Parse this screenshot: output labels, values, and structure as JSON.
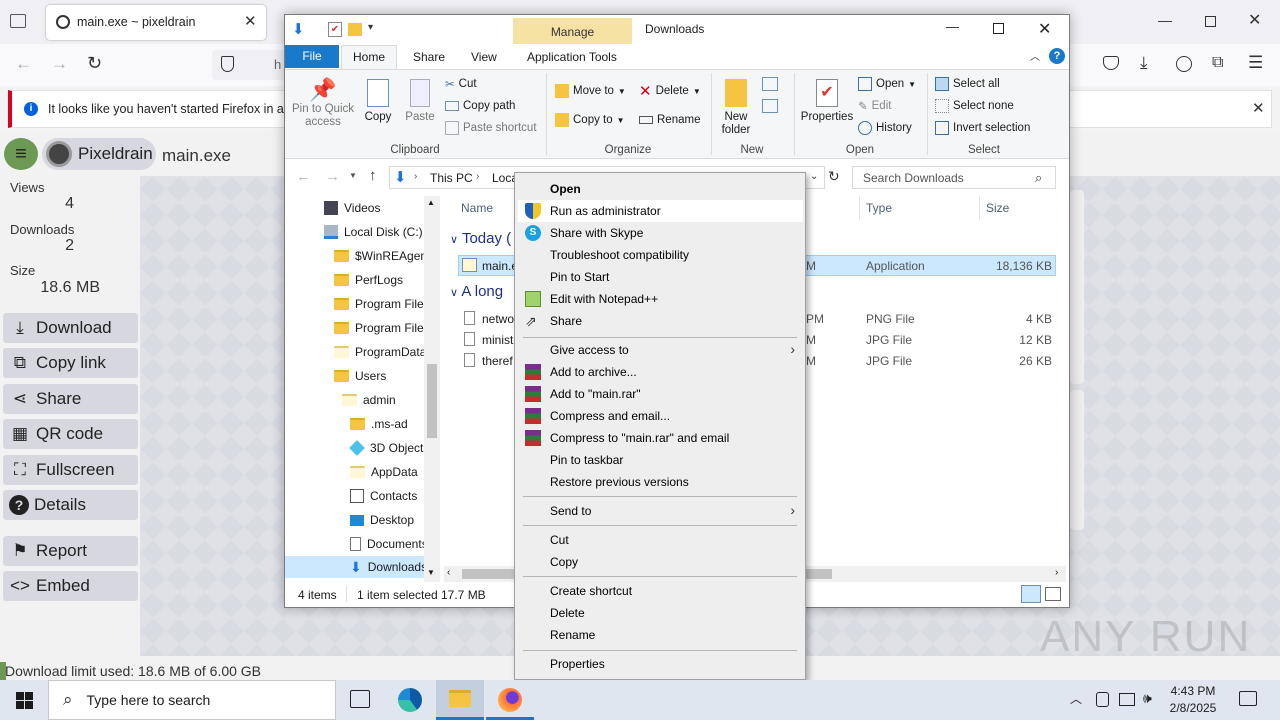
{
  "firefox": {
    "tab_title": "main.exe ~ pixeldrain",
    "url_prefix": "h",
    "notice_text": "It looks like you haven't started Firefox in a wh"
  },
  "pixeldrain": {
    "brand": "Pixeldrain",
    "filename": "main.exe",
    "stats": [
      {
        "label": "Views",
        "value": "4"
      },
      {
        "label": "Downloads",
        "value": "2"
      },
      {
        "label": "Size",
        "value": "18.6 MB"
      }
    ],
    "buttons": [
      "Download",
      "Copy link",
      "Share",
      "QR code",
      "Fullscreen",
      "Details",
      "Report",
      "Embed"
    ],
    "limit_text": "Download limit used: 18.6 MB of 6.00 GB"
  },
  "explorer": {
    "window_title": "Downloads",
    "manage_tab": "Manage",
    "tabs": [
      "File",
      "Home",
      "Share",
      "View",
      "Application Tools"
    ],
    "clipboard": {
      "pin": "Pin to Quick access",
      "copy": "Copy",
      "paste": "Paste",
      "cut": "Cut",
      "copy_path": "Copy path",
      "paste_shortcut": "Paste shortcut",
      "label": "Clipboard"
    },
    "organize": {
      "move_to": "Move to",
      "copy_to": "Copy to",
      "delete": "Delete",
      "rename": "Rename",
      "label": "Organize"
    },
    "new": {
      "new_folder": "New folder",
      "label": "New"
    },
    "open": {
      "properties": "Properties",
      "open": "Open",
      "edit": "Edit",
      "history": "History",
      "label": "Open"
    },
    "select": {
      "select_all": "Select all",
      "select_none": "Select none",
      "invert": "Invert selection",
      "label": "Select"
    },
    "breadcrumb": [
      "This PC",
      "Loca"
    ],
    "search_placeholder": "Search Downloads",
    "tree": [
      "Videos",
      "Local Disk (C:)",
      "$WinREAgent",
      "PerfLogs",
      "Program Files",
      "Program Files",
      "ProgramData",
      "Users",
      "admin",
      ".ms-ad",
      "3D Objects",
      "AppData",
      "Contacts",
      "Desktop",
      "Documents",
      "Downloads"
    ],
    "columns": {
      "name": "Name",
      "type": "Type",
      "size": "Size"
    },
    "groups": [
      "Today (",
      "A long"
    ],
    "files": [
      {
        "name": "main.e",
        "date": "M",
        "type": "Application",
        "size": "18,136 KB"
      },
      {
        "name": "netwo",
        "date": "PM",
        "type": "PNG File",
        "size": "4 KB"
      },
      {
        "name": "minist",
        "date": "M",
        "type": "JPG File",
        "size": "12 KB"
      },
      {
        "name": "theref",
        "date": "M",
        "type": "JPG File",
        "size": "26 KB"
      }
    ],
    "status": {
      "items": "4 items",
      "selected": "1 item selected",
      "size": "17.7 MB"
    }
  },
  "context_menu": {
    "items": [
      {
        "label": "Open",
        "bold": true
      },
      {
        "label": "Run as administrator",
        "icon": "shield-icon"
      },
      {
        "label": "Share with Skype",
        "icon": "skype-icon"
      },
      {
        "label": "Troubleshoot compatibility"
      },
      {
        "label": "Pin to Start"
      },
      {
        "label": "Edit with Notepad++",
        "icon": "notepad-icon"
      },
      {
        "label": "Share",
        "icon": "share-icon"
      },
      {
        "label": "Give access to",
        "submenu": true
      },
      {
        "label": "Add to archive...",
        "icon": "winrar-icon"
      },
      {
        "label": "Add to \"main.rar\"",
        "icon": "winrar-icon"
      },
      {
        "label": "Compress and email...",
        "icon": "winrar-icon"
      },
      {
        "label": "Compress to \"main.rar\" and email",
        "icon": "winrar-icon"
      },
      {
        "label": "Pin to taskbar"
      },
      {
        "label": "Restore previous versions"
      },
      {
        "label": "Send to",
        "submenu": true
      },
      {
        "label": "Cut"
      },
      {
        "label": "Copy"
      },
      {
        "label": "Create shortcut"
      },
      {
        "label": "Delete"
      },
      {
        "label": "Rename"
      },
      {
        "label": "Properties"
      }
    ]
  },
  "taskbar": {
    "search_placeholder": "Type here to search",
    "time": "4:43 PM",
    "date": "2/8/2025"
  },
  "watermark": "ANY RUN"
}
